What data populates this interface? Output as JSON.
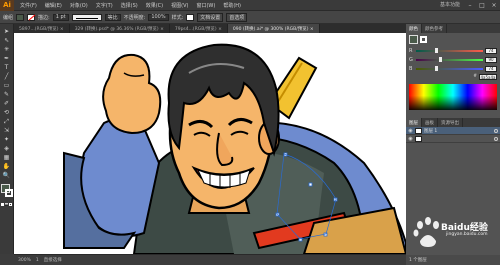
{
  "app": {
    "logo": "Ai",
    "workspace": "基本功能"
  },
  "menu": [
    "文件(F)",
    "编辑(E)",
    "对象(O)",
    "文字(T)",
    "选择(S)",
    "效果(C)",
    "视图(V)",
    "窗口(W)",
    "帮助(H)"
  ],
  "window_controls": [
    "–",
    "□",
    "×"
  ],
  "control_bar": {
    "selection_label": "编组",
    "stroke_label": "描边:",
    "stroke_value": "1 pt",
    "stroke_style_label": "等比",
    "opacity_label": "不透明度:",
    "opacity_value": "100%",
    "style_label": "样式:",
    "doc_setup": "文档设置",
    "preferences": "首选项",
    "fill_color": "#4a5a4a",
    "stroke_color": "#ff0000"
  },
  "tabs": [
    {
      "label": "5897...(RGB/预览) ×",
      "active": false
    },
    {
      "label": "329 (转换).psd* @ 36.36% (RGB/预览) ×",
      "active": false
    },
    {
      "label": "79ps4...(RGB/预览) ×",
      "active": false
    },
    {
      "label": "090 (转换).ai* @ 300% (RGB/预览) ×",
      "active": true
    }
  ],
  "tools": [
    "➤",
    "⇖",
    "✳",
    "✒",
    "T",
    "╱",
    "▭",
    "✎",
    "✐",
    "⟲",
    "⤢",
    "⇲",
    "✦",
    "◈",
    "▦",
    "✋",
    "🔍"
  ],
  "status": {
    "zoom": "300%",
    "page": "1",
    "mode": "直接选择"
  },
  "panels": {
    "color_tabs": [
      "颜色",
      "颜色参考"
    ],
    "sliders": [
      {
        "label": "R",
        "value": "74"
      },
      {
        "label": "G",
        "value": "90"
      },
      {
        "label": "B",
        "value": "74"
      }
    ],
    "hex_value": "4a5a4a",
    "layer_tabs": [
      "图层",
      "画板",
      "资源导出"
    ],
    "layers": [
      {
        "name": "图层 1",
        "selected": true
      },
      {
        "name": "",
        "selected": false
      }
    ],
    "layers_count": "1 个图层"
  },
  "watermark": {
    "text": "Baidu经验",
    "sub": "jingyan.baidu.com"
  }
}
